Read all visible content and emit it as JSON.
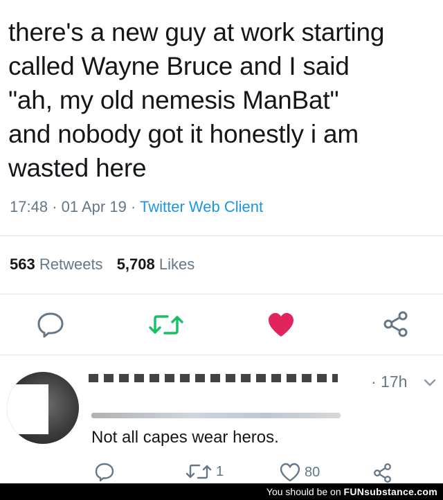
{
  "tweet": {
    "text": "there's a new guy at work starting\ncalled Wayne Bruce and I said\n\"ah, my old nemesis ManBat\"\nand nobody got it honestly i am\nwasted here",
    "time": "17:48",
    "separator": "·",
    "date": "01 Apr 19",
    "client": "Twitter Web Client",
    "retweets_count": "563",
    "retweets_label": "Retweets",
    "likes_count": "5,708",
    "likes_label": "Likes"
  },
  "actions": {
    "reply_icon": "reply-icon",
    "retweet_icon": "retweet-icon",
    "like_icon": "heart-icon",
    "share_icon": "share-icon"
  },
  "reply": {
    "time": "· 17h",
    "text": "Not all capes wear heros.",
    "retweet_count": "1",
    "like_count": "80"
  },
  "watermark": {
    "prefix": "You should be on",
    "brand": "FUNsubstance.com"
  },
  "colors": {
    "text": "#14171a",
    "muted": "#657786",
    "link": "#1b95e0",
    "retweet": "#17bf63",
    "like": "#e0245e",
    "divider": "#e1e8ed"
  }
}
